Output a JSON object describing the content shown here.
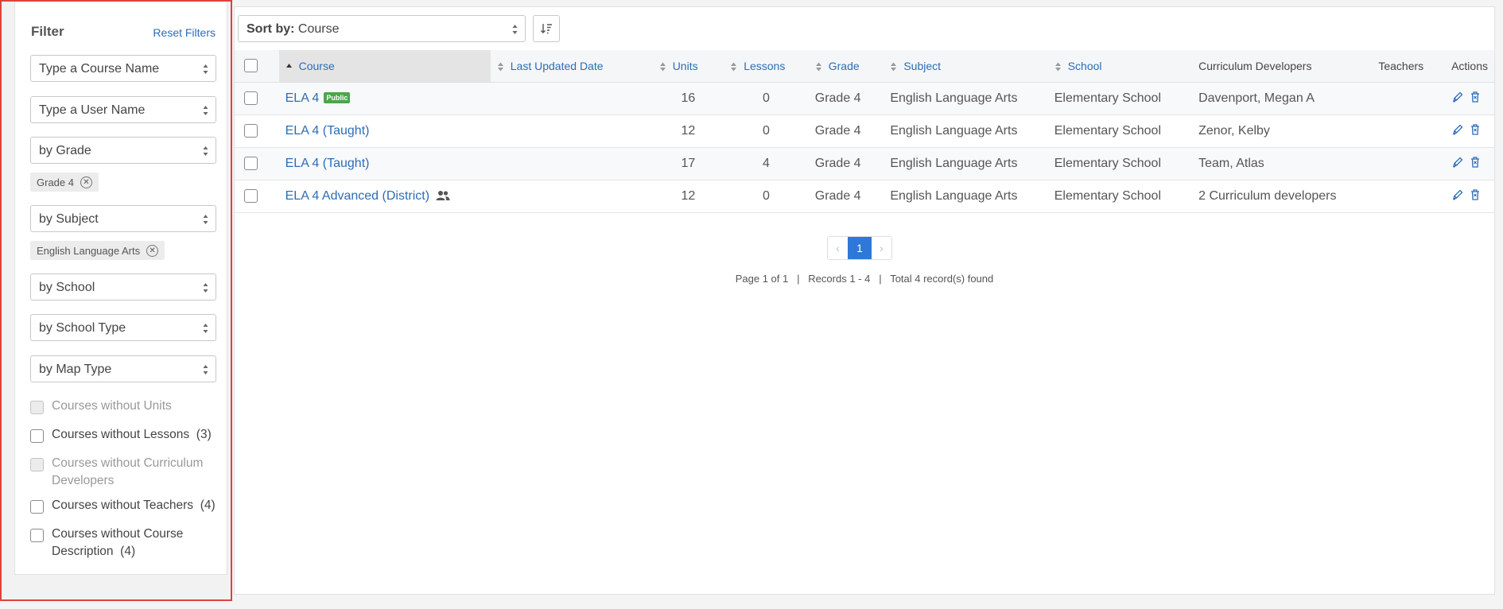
{
  "filter": {
    "title": "Filter",
    "reset": "Reset Filters",
    "course_name_placeholder": "Type a Course Name",
    "user_name_placeholder": "Type a User Name",
    "grade_select": "by Grade",
    "grade_chip": "Grade 4",
    "subject_select": "by Subject",
    "subject_chip": "English Language Arts",
    "school_select": "by School",
    "school_type_select": "by School Type",
    "map_type_select": "by Map Type",
    "checkboxes": [
      {
        "label": "Courses without Units",
        "count": "",
        "disabled": true
      },
      {
        "label": "Courses without Lessons",
        "count": "(3)",
        "disabled": false
      },
      {
        "label": "Courses without Curriculum Developers",
        "count": "",
        "disabled": true
      },
      {
        "label": "Courses without Teachers",
        "count": "(4)",
        "disabled": false
      },
      {
        "label": "Courses without Course Description",
        "count": "(4)",
        "disabled": false
      }
    ]
  },
  "toolbar": {
    "sort_label": "Sort by:",
    "sort_value": "Course"
  },
  "table": {
    "headers": {
      "course": "Course",
      "last_updated": "Last Updated Date",
      "units": "Units",
      "lessons": "Lessons",
      "grade": "Grade",
      "subject": "Subject",
      "school": "School",
      "developers": "Curriculum Developers",
      "teachers": "Teachers",
      "actions": "Actions"
    },
    "rows": [
      {
        "course": "ELA 4",
        "badge": "Public",
        "group": false,
        "units": "16",
        "lessons": "0",
        "grade": "Grade 4",
        "subject": "English Language Arts",
        "school": "Elementary School",
        "developers": "Davenport, Megan A"
      },
      {
        "course": "ELA 4 (Taught)",
        "badge": "",
        "group": false,
        "units": "12",
        "lessons": "0",
        "grade": "Grade 4",
        "subject": "English Language Arts",
        "school": "Elementary School",
        "developers": "Zenor, Kelby"
      },
      {
        "course": "ELA 4 (Taught)",
        "badge": "",
        "group": false,
        "units": "17",
        "lessons": "4",
        "grade": "Grade 4",
        "subject": "English Language Arts",
        "school": "Elementary School",
        "developers": "Team, Atlas"
      },
      {
        "course": "ELA 4 Advanced (District)",
        "badge": "",
        "group": true,
        "units": "12",
        "lessons": "0",
        "grade": "Grade 4",
        "subject": "English Language Arts",
        "school": "Elementary School",
        "developers": "2 Curriculum developers"
      }
    ]
  },
  "pagination": {
    "current_page": "1",
    "page_info": "Page 1 of 1",
    "records": "Records 1 - 4",
    "total": "Total 4 record(s) found",
    "separator": "|"
  },
  "colors": {
    "accent": "#2d6db5",
    "highlight_border": "#e0403e",
    "public_badge": "#4ba64b",
    "current_page": "#2d78d8"
  }
}
